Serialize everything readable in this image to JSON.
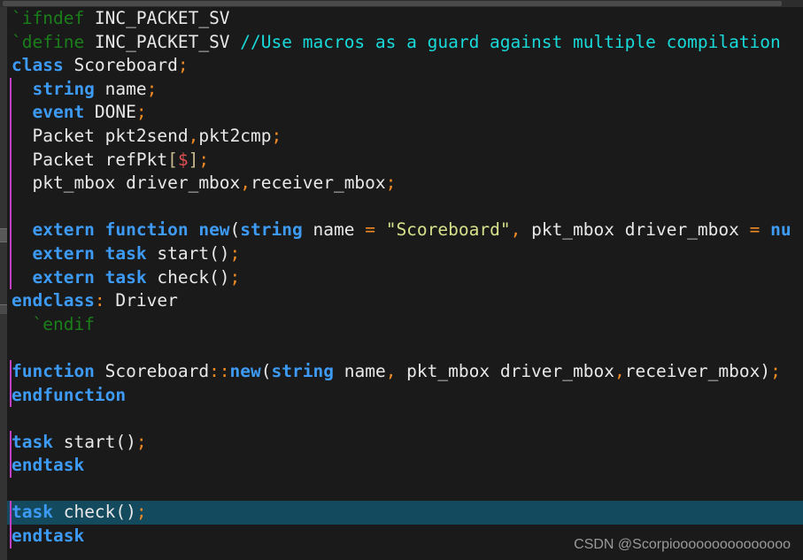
{
  "editor": {
    "background": "#1a1a1a",
    "gutter_color": "#333333",
    "indent_guide_color": "#c23ec2",
    "selection_color": "#134a5e",
    "language": "SystemVerilog"
  },
  "colors": {
    "keyword": "#3d9bf5",
    "identifier": "#e8e8e8",
    "macro": "#1a7f1a",
    "comment": "#19d9d9",
    "punctuation": "#f08a24",
    "string": "#d7e08a",
    "dollar": "#e05252",
    "bracket": "#c7b98f"
  },
  "code": {
    "lines": [
      {
        "id": "line-1",
        "guide": false,
        "selected": false,
        "tokens": [
          {
            "text": "`ifndef",
            "type": "macro"
          },
          {
            "text": " INC_PACKET_SV",
            "type": "plain"
          }
        ]
      },
      {
        "id": "line-2",
        "guide": false,
        "selected": false,
        "tokens": [
          {
            "text": "`define",
            "type": "macro"
          },
          {
            "text": " INC_PACKET_SV ",
            "type": "plain"
          },
          {
            "text": "//Use macros as a guard against multiple compilation",
            "type": "comment"
          }
        ]
      },
      {
        "id": "line-3",
        "guide": false,
        "selected": false,
        "tokens": [
          {
            "text": "class",
            "type": "keyword"
          },
          {
            "text": " Scoreboard",
            "type": "plain"
          },
          {
            "text": ";",
            "type": "punctuation"
          }
        ]
      },
      {
        "id": "line-4",
        "guide": true,
        "selected": false,
        "tokens": [
          {
            "text": "  ",
            "type": "plain"
          },
          {
            "text": "string",
            "type": "keyword"
          },
          {
            "text": " name",
            "type": "plain"
          },
          {
            "text": ";",
            "type": "punctuation"
          }
        ]
      },
      {
        "id": "line-5",
        "guide": true,
        "selected": false,
        "tokens": [
          {
            "text": "  ",
            "type": "plain"
          },
          {
            "text": "event",
            "type": "keyword"
          },
          {
            "text": " DONE",
            "type": "plain"
          },
          {
            "text": ";",
            "type": "punctuation"
          }
        ]
      },
      {
        "id": "line-6",
        "guide": true,
        "selected": false,
        "tokens": [
          {
            "text": "  Packet pkt2send",
            "type": "plain"
          },
          {
            "text": ",",
            "type": "punctuation"
          },
          {
            "text": "pkt2cmp",
            "type": "plain"
          },
          {
            "text": ";",
            "type": "punctuation"
          }
        ]
      },
      {
        "id": "line-7",
        "guide": true,
        "selected": false,
        "tokens": [
          {
            "text": "  Packet refPkt",
            "type": "plain"
          },
          {
            "text": "[",
            "type": "bracket"
          },
          {
            "text": "$",
            "type": "dollar"
          },
          {
            "text": "]",
            "type": "bracket"
          },
          {
            "text": ";",
            "type": "punctuation"
          }
        ]
      },
      {
        "id": "line-8",
        "guide": true,
        "selected": false,
        "tokens": [
          {
            "text": "  pkt_mbox driver_mbox",
            "type": "plain"
          },
          {
            "text": ",",
            "type": "punctuation"
          },
          {
            "text": "receiver_mbox",
            "type": "plain"
          },
          {
            "text": ";",
            "type": "punctuation"
          }
        ]
      },
      {
        "id": "line-9",
        "guide": true,
        "selected": false,
        "tokens": []
      },
      {
        "id": "line-10",
        "guide": true,
        "selected": false,
        "tokens": [
          {
            "text": "  ",
            "type": "plain"
          },
          {
            "text": "extern function new",
            "type": "keyword"
          },
          {
            "text": "(",
            "type": "plain"
          },
          {
            "text": "string",
            "type": "keyword"
          },
          {
            "text": " name ",
            "type": "plain"
          },
          {
            "text": "=",
            "type": "punctuation"
          },
          {
            "text": " ",
            "type": "plain"
          },
          {
            "text": "\"Scoreboard\"",
            "type": "string"
          },
          {
            "text": ",",
            "type": "punctuation"
          },
          {
            "text": " pkt_mbox driver_mbox ",
            "type": "plain"
          },
          {
            "text": "=",
            "type": "punctuation"
          },
          {
            "text": " ",
            "type": "plain"
          },
          {
            "text": "nu",
            "type": "keyword"
          }
        ]
      },
      {
        "id": "line-11",
        "guide": true,
        "selected": false,
        "tokens": [
          {
            "text": "  ",
            "type": "plain"
          },
          {
            "text": "extern task",
            "type": "keyword"
          },
          {
            "text": " start()",
            "type": "plain"
          },
          {
            "text": ";",
            "type": "punctuation"
          }
        ]
      },
      {
        "id": "line-12",
        "guide": true,
        "selected": false,
        "tokens": [
          {
            "text": "  ",
            "type": "plain"
          },
          {
            "text": "extern task",
            "type": "keyword"
          },
          {
            "text": " check()",
            "type": "plain"
          },
          {
            "text": ";",
            "type": "punctuation"
          }
        ]
      },
      {
        "id": "line-13",
        "guide": false,
        "selected": false,
        "tokens": [
          {
            "text": "endclass",
            "type": "keyword"
          },
          {
            "text": ":",
            "type": "punctuation"
          },
          {
            "text": " Driver",
            "type": "plain"
          }
        ]
      },
      {
        "id": "line-14",
        "guide": false,
        "selected": false,
        "tokens": [
          {
            "text": "  `endif",
            "type": "macro"
          }
        ]
      },
      {
        "id": "line-15",
        "guide": false,
        "selected": false,
        "tokens": []
      },
      {
        "id": "line-16",
        "guide": true,
        "selected": false,
        "tokens": [
          {
            "text": "function",
            "type": "keyword"
          },
          {
            "text": " Scoreboard",
            "type": "plain"
          },
          {
            "text": "::",
            "type": "punctuation"
          },
          {
            "text": "new",
            "type": "keyword"
          },
          {
            "text": "(",
            "type": "plain"
          },
          {
            "text": "string",
            "type": "keyword"
          },
          {
            "text": " name",
            "type": "plain"
          },
          {
            "text": ",",
            "type": "punctuation"
          },
          {
            "text": " pkt_mbox driver_mbox",
            "type": "plain"
          },
          {
            "text": ",",
            "type": "punctuation"
          },
          {
            "text": "receiver_mbox)",
            "type": "plain"
          },
          {
            "text": ";",
            "type": "punctuation"
          }
        ]
      },
      {
        "id": "line-17",
        "guide": true,
        "selected": false,
        "tokens": [
          {
            "text": "endfunction",
            "type": "keyword"
          }
        ]
      },
      {
        "id": "line-18",
        "guide": false,
        "selected": false,
        "tokens": []
      },
      {
        "id": "line-19",
        "guide": true,
        "selected": false,
        "tokens": [
          {
            "text": "task",
            "type": "keyword"
          },
          {
            "text": " start()",
            "type": "plain"
          },
          {
            "text": ";",
            "type": "punctuation"
          }
        ]
      },
      {
        "id": "line-20",
        "guide": true,
        "selected": false,
        "tokens": [
          {
            "text": "endtask",
            "type": "keyword"
          }
        ]
      },
      {
        "id": "line-21",
        "guide": false,
        "selected": false,
        "tokens": []
      },
      {
        "id": "line-22",
        "guide": true,
        "selected": true,
        "tokens": [
          {
            "text": "task",
            "type": "keyword"
          },
          {
            "text": " check()",
            "type": "plain"
          },
          {
            "text": ";",
            "type": "punctuation"
          }
        ]
      },
      {
        "id": "line-23",
        "guide": true,
        "selected": false,
        "tokens": [
          {
            "text": "endtask",
            "type": "keyword"
          }
        ]
      }
    ]
  },
  "watermark": {
    "text": "CSDN @Scorpiooooooooooooooo"
  }
}
